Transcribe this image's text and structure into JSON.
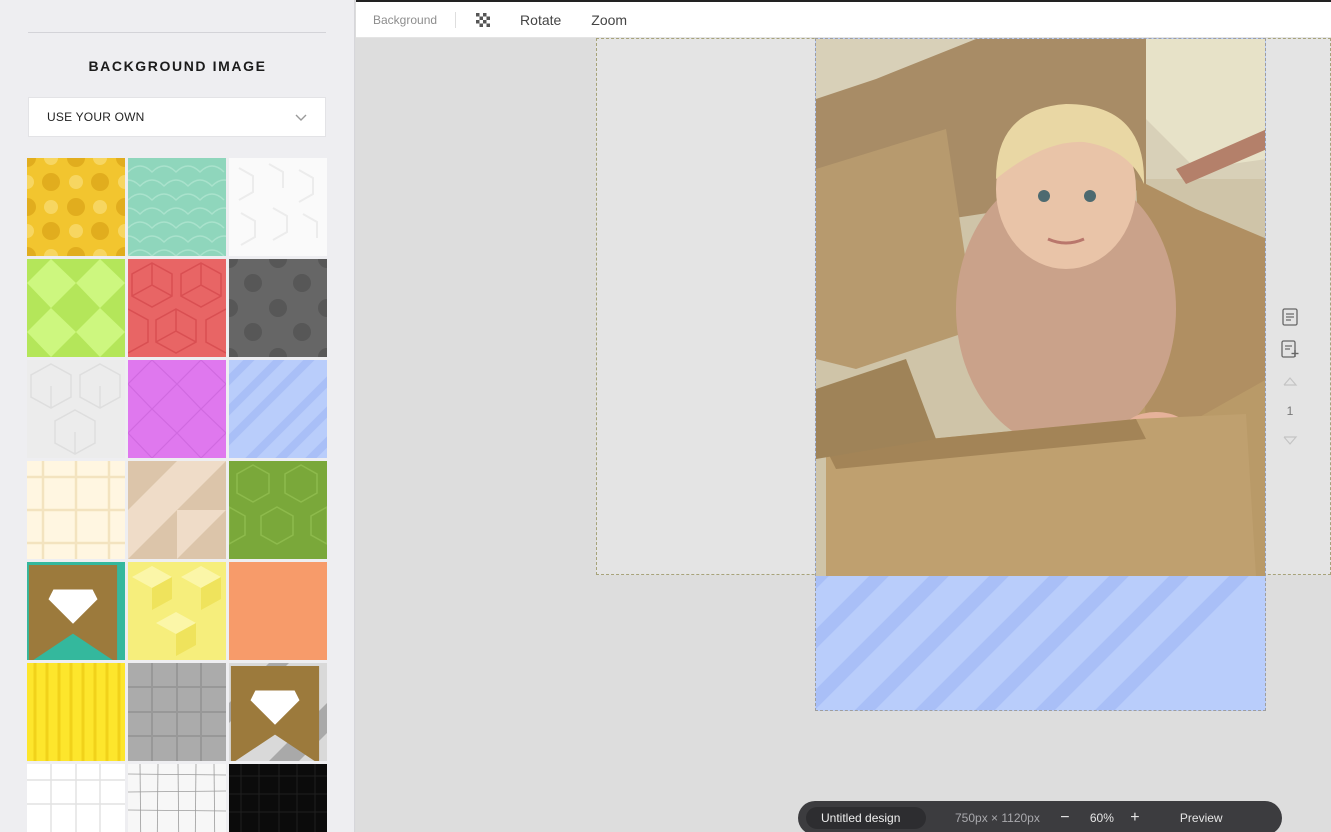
{
  "toolbar": {
    "background_label": "Background",
    "rotate_label": "Rotate",
    "zoom_label": "Zoom"
  },
  "sidebar": {
    "title": "BACKGROUND IMAGE",
    "dropdown_value": "USE YOUR OWN",
    "tiles": [
      {
        "pattern": "yellow-dots",
        "premium": false
      },
      {
        "pattern": "mint-waves",
        "premium": false
      },
      {
        "pattern": "white-geometric",
        "premium": false
      },
      {
        "pattern": "lime-argyle",
        "premium": false
      },
      {
        "pattern": "red-cubes",
        "premium": false
      },
      {
        "pattern": "gray-dots",
        "premium": false
      },
      {
        "pattern": "light-gray-cubes",
        "premium": false
      },
      {
        "pattern": "pink-argyle",
        "premium": false
      },
      {
        "pattern": "blue-stripes",
        "premium": false
      },
      {
        "pattern": "cream-grid",
        "premium": false
      },
      {
        "pattern": "beige-triangles",
        "premium": false
      },
      {
        "pattern": "green-hexagons",
        "premium": false
      },
      {
        "pattern": "teal-solid",
        "premium": true
      },
      {
        "pattern": "yellow-cubes",
        "premium": false
      },
      {
        "pattern": "orange-solid",
        "premium": false
      },
      {
        "pattern": "yellow-vertical-stripes",
        "premium": false
      },
      {
        "pattern": "gray-plaid",
        "premium": false
      },
      {
        "pattern": "gray-diagonal",
        "premium": true
      },
      {
        "pattern": "white-grid",
        "premium": false
      },
      {
        "pattern": "white-sketch-grid",
        "premium": false
      },
      {
        "pattern": "black-grid",
        "premium": false
      }
    ]
  },
  "canvas": {
    "page_number": "1",
    "page_background": "blue-stripes"
  },
  "bottombar": {
    "design_name": "Untitled design",
    "dimensions": "750px × 1120px",
    "zoom": "60%",
    "preview_label": "Preview"
  },
  "colors": {
    "accent_dark": "#3c3c3f",
    "sidebar_bg": "#eeeef1",
    "canvas_bg": "#dddddd"
  }
}
